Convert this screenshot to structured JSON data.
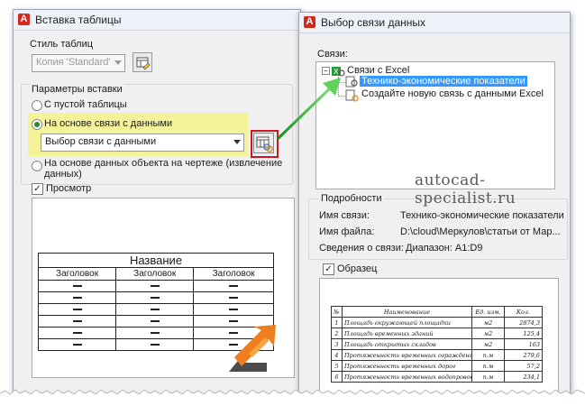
{
  "insert_dialog": {
    "title": "Вставка таблицы",
    "table_style_label": "Стиль таблиц",
    "table_style_value": "Копия 'Standard'",
    "insert_params_label": "Параметры вставки",
    "option_empty": "С пустой таблицы",
    "option_data_link": "На основе связи с данными",
    "data_link_value": "Выбор связи с данными",
    "option_extract_line1": "На основе данных объекта на чертеже (извлечение",
    "option_extract_line2": "данных)",
    "preview_label": "Просмотр",
    "preview_table": {
      "title": "Название",
      "headers": [
        "Заголовок",
        "Заголовок",
        "Заголовок"
      ]
    }
  },
  "link_dialog": {
    "title": "Выбор связи данных",
    "links_label": "Связи:",
    "tree": {
      "root": "Связи с Excel",
      "selected": "Технико-экономические показатели",
      "new_link": "Создайте новую связь с данными Excel"
    },
    "details_label": "Подробности",
    "details": [
      {
        "key": "Имя связи:",
        "value": "Технико-экономические показатели"
      },
      {
        "key": "Имя файла:",
        "value": "D:\\cloud\\Меркулов\\статьи от Мар..."
      },
      {
        "key": "Сведения о связи:",
        "value": "Диапазон: A1:D9"
      }
    ],
    "sample_label": "Образец",
    "sample_table": {
      "headers": [
        "№",
        "Наименование",
        "Ед. изм.",
        "Кол."
      ],
      "rows": [
        [
          "1",
          "Площадь окружающей площадки",
          "м2",
          "2874,3"
        ],
        [
          "2",
          "Площадь временных зданий",
          "м2",
          "125,4"
        ],
        [
          "3",
          "Площадь открытых складов",
          "м2",
          "163"
        ],
        [
          "4",
          "Протяженность временных ограждений",
          "п.м",
          "279,6"
        ],
        [
          "5",
          "Протяженность временных дорог",
          "п.м",
          "57,2"
        ],
        [
          "6",
          "Протяженность временных водопроводных сетей",
          "п.м",
          "234,1"
        ]
      ]
    }
  },
  "watermark": "autocad-specialist.ru",
  "colors": {
    "highlight": "#f4f39a",
    "selection": "#3399ff",
    "arrow": "#19b319",
    "callout": "#d2161d"
  }
}
